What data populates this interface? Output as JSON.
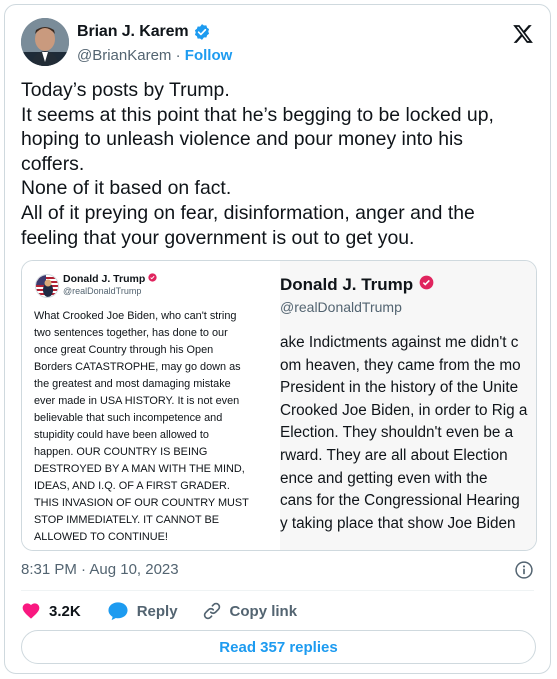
{
  "author": {
    "name": "Brian J. Karem",
    "handle": "@BrianKarem",
    "separator": " · ",
    "follow_label": "Follow"
  },
  "tweet_text": [
    "Today’s posts by Trump.",
    "It seems at this point that he’s begging to be locked up,",
    "hoping to unleash violence and pour money into his",
    "coffers.",
    "None of it based on fact.",
    "All of it preying on fear, disinformation, anger and the",
    "feeling that your government is out to get you."
  ],
  "media": {
    "left": {
      "name": "Donald J. Trump",
      "handle": "@realDonaldTrump",
      "lines": [
        "What Crooked Joe Biden, who can't string",
        "two sentences together, has done to our",
        "once great Country through his Open",
        "Borders CATASTROPHE, may go down as",
        "the greatest and most damaging mistake",
        "ever made in USA HISTORY. It is not even",
        "believable that such incompetence and",
        "stupidity could have been allowed to",
        "happen. OUR COUNTRY IS BEING",
        "DESTROYED BY A MAN WITH THE MIND,",
        "IDEAS, AND I.Q. OF A FIRST GRADER.",
        "THIS INVASION OF OUR COUNTRY MUST",
        "STOP IMMEDIATELY. IT CANNOT BE",
        "ALLOWED TO CONTINUE!"
      ]
    },
    "right": {
      "name": "Donald J. Trump",
      "handle": "@realDonaldTrump",
      "lines": [
        "ake Indictments against me didn't c",
        "om heaven, they came from the mo",
        "President in the history of the Unite",
        "Crooked Joe Biden, in order to Rig a",
        "Election. They shouldn't even be a",
        "rward. They are all about Election",
        "ence and getting even with the",
        "cans for the Congressional Hearing",
        "y taking place that show Joe Biden"
      ]
    }
  },
  "timestamp": "8:31 PM · Aug 10, 2023",
  "actions": {
    "likes": "3.2K",
    "reply_label": "Reply",
    "copy_label": "Copy link"
  },
  "read_replies_label": "Read 357 replies",
  "colors": {
    "accent": "#1d9bf0",
    "like": "#f91880",
    "secondary_text": "#536471",
    "border": "#cfd9de"
  },
  "icons": [
    "verified-badge-icon",
    "x-logo-icon",
    "info-icon",
    "heart-icon",
    "reply-bubble-icon",
    "link-icon"
  ]
}
